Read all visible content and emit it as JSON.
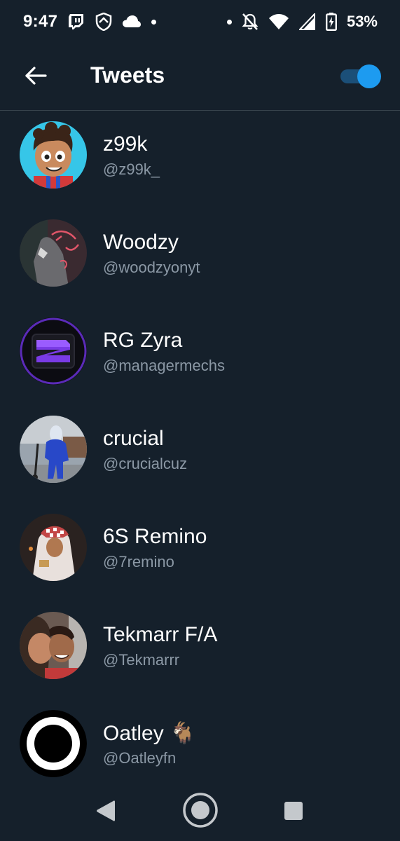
{
  "status_bar": {
    "time": "9:47",
    "battery": "53%",
    "icons": [
      "twitch-icon",
      "shield-icon",
      "cloud-icon",
      "dot-icon",
      "dot-icon",
      "notifications-off-icon",
      "wifi-icon",
      "signal-icon",
      "battery-charging-icon"
    ]
  },
  "header": {
    "title": "Tweets",
    "toggle_on": true,
    "accent": "#1d9bf0"
  },
  "users": [
    {
      "name": "z99k",
      "handle": "@z99k_",
      "avatar": "cartoon-avatar"
    },
    {
      "name": "Woodzy",
      "handle": "@woodzyonyt",
      "avatar": "neon-sign-avatar"
    },
    {
      "name": "RG Zyra",
      "handle": "@managermechs",
      "avatar": "purple-logo-avatar"
    },
    {
      "name": "crucial",
      "handle": "@crucialcuz",
      "avatar": "person-photo-avatar"
    },
    {
      "name": "6S Remino",
      "handle": "@7remino",
      "avatar": "person-photo-avatar"
    },
    {
      "name": "Tekmarr F/A",
      "handle": "@Tekmarrr",
      "avatar": "person-photo-avatar"
    },
    {
      "name": "Oatley 🐐",
      "handle": "@Oatleyfn",
      "avatar": "ring-logo-avatar"
    }
  ],
  "colors": {
    "background": "#15202b",
    "secondary_text": "#8b98a5",
    "divider": "#38444d"
  }
}
